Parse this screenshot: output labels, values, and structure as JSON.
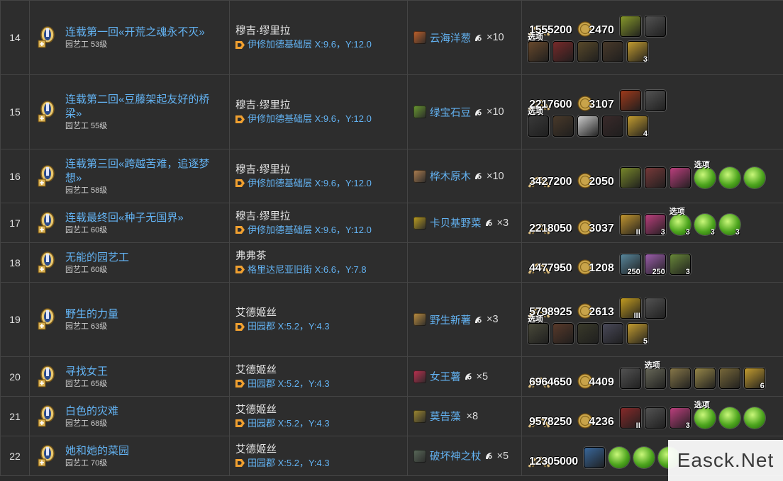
{
  "option_label": "选项",
  "rows": [
    {
      "num": "14",
      "quest": "连载第一回«开荒之魂永不灭»",
      "level": "园艺工 53级",
      "npc": "穆吉·缪里拉",
      "loc": "伊修加德基础层 X:9.6，Y:12.0",
      "item": "云海洋葱",
      "item_color": "#c4622a",
      "qty": "×10",
      "hq": true,
      "xp": "1555200",
      "gil": "2470",
      "icons": [
        {
          "c": "#8a9d2b"
        },
        {
          "c": "#555"
        }
      ],
      "icons2": [
        {
          "c": "#6a4a2c"
        },
        {
          "c": "#7a2a2a"
        },
        {
          "c": "#5a4a2a"
        },
        {
          "c": "#4a3a2a"
        },
        {
          "c": "#c8a030",
          "n": "3"
        }
      ],
      "opt": "row2"
    },
    {
      "num": "15",
      "quest": "连载第二回«豆藤架起友好的桥梁»",
      "level": "园艺工 55级",
      "npc": "穆吉·缪里拉",
      "loc": "伊修加德基础层 X:9.6，Y:12.0",
      "item": "绿宝石豆",
      "item_color": "#6a9a30",
      "qty": "×10",
      "hq": true,
      "xp": "2217600",
      "gil": "3107",
      "icons": [
        {
          "c": "#a33a1a"
        },
        {
          "c": "#555"
        }
      ],
      "icons2": [
        {
          "c": "#3a3a3a"
        },
        {
          "c": "#4a3a2a"
        },
        {
          "c": "#d0d0d0"
        },
        {
          "c": "#3a2a2a"
        },
        {
          "c": "#c8a030",
          "n": "4"
        }
      ],
      "opt": "row2"
    },
    {
      "num": "16",
      "quest": "连载第三回«跨越苦难，追逐梦想»",
      "level": "园艺工 58级",
      "npc": "穆吉·缪里拉",
      "loc": "伊修加德基础层 X:9.6，Y:12.0",
      "item": "桦木原木",
      "item_color": "#b08050",
      "qty": "×10",
      "hq": true,
      "xp": "3427200",
      "gil": "2050",
      "icons": [
        {
          "c": "#7a8a2a"
        },
        {
          "c": "#7a3a3a"
        },
        {
          "c": "#c04080"
        },
        {
          "c": "orb",
          "opt": true
        },
        {
          "c": "orb"
        },
        {
          "c": "orb"
        }
      ],
      "icons2": [],
      "opt": "inline"
    },
    {
      "num": "17",
      "quest": "连载最终回«种子无国界»",
      "level": "园艺工 60级",
      "npc": "穆吉·缪里拉",
      "loc": "伊修加德基础层 X:9.6，Y:12.0",
      "item": "卡贝基野菜",
      "item_color": "#c0a020",
      "qty": "×3",
      "hq": true,
      "xp": "2218050",
      "gil": "3037",
      "icons": [
        {
          "c": "#c89a30",
          "n": "II"
        },
        {
          "c": "#c04080",
          "n": "3"
        },
        {
          "c": "orb",
          "n": "3",
          "opt": true
        },
        {
          "c": "orb",
          "n": "3"
        },
        {
          "c": "orb",
          "n": "3"
        }
      ],
      "icons2": [],
      "opt": "inline"
    },
    {
      "num": "18",
      "quest": "无能的园艺工",
      "level": "园艺工 60级",
      "npc": "弗弗茶",
      "loc": "格里达尼亚旧街 X:6.6，Y:7.8",
      "item": "",
      "item_color": "",
      "qty": "",
      "hq": false,
      "xp": "4477950",
      "gil": "1208",
      "icons": [
        {
          "c": "#5a8aa0",
          "n": "250"
        },
        {
          "c": "#a060b0",
          "n": "250"
        },
        {
          "c": "#6a8a3a",
          "n": "3"
        }
      ],
      "icons2": [],
      "opt": "none"
    },
    {
      "num": "19",
      "quest": "野生的力量",
      "level": "园艺工 63级",
      "npc": "艾德姬丝",
      "loc": "田园郡 X:5.2，Y:4.3",
      "item": "野生新薯",
      "item_color": "#c09040",
      "qty": "×3",
      "hq": true,
      "xp": "5798925",
      "gil": "2613",
      "icons": [
        {
          "c": "#c8a020",
          "n": "III"
        },
        {
          "c": "#555"
        }
      ],
      "icons2": [
        {
          "c": "#4a4a3a"
        },
        {
          "c": "#5a3a2a"
        },
        {
          "c": "#3a3a2a"
        },
        {
          "c": "#4a4a5a"
        },
        {
          "c": "#c8a030",
          "n": "5"
        }
      ],
      "opt": "row2"
    },
    {
      "num": "20",
      "quest": "寻找女王",
      "level": "园艺工 65级",
      "npc": "艾德姬丝",
      "loc": "田园郡 X:5.2，Y:4.3",
      "item": "女王薯",
      "item_color": "#c03050",
      "qty": "×5",
      "hq": true,
      "xp": "6964650",
      "gil": "4409",
      "icons": [
        {
          "c": "#555"
        },
        {
          "c": "#6a6a5a",
          "opt": true
        },
        {
          "c": "#8a7a4a"
        },
        {
          "c": "#9a8a4a"
        },
        {
          "c": "#7a6a3a"
        },
        {
          "c": "#c8a030",
          "n": "6"
        }
      ],
      "icons2": [],
      "opt": "inline"
    },
    {
      "num": "21",
      "quest": "白色的灾难",
      "level": "园艺工 68级",
      "npc": "艾德姬丝",
      "loc": "田园郡 X:5.2，Y:4.3",
      "item": "莫告藻",
      "item_color": "#a08a30",
      "qty": "×8",
      "hq": false,
      "xp": "9578250",
      "gil": "4236",
      "icons": [
        {
          "c": "#8a2a2a",
          "n": "II"
        },
        {
          "c": "#555"
        },
        {
          "c": "#c04080",
          "n": "3"
        },
        {
          "c": "orb",
          "opt": true
        },
        {
          "c": "orb"
        },
        {
          "c": "orb"
        }
      ],
      "icons2": [],
      "opt": "inline"
    },
    {
      "num": "22",
      "quest": "她和她的菜园",
      "level": "园艺工 70级",
      "npc": "艾德姬丝",
      "loc": "田园郡 X:5.2，Y:4.3",
      "item": "破坏神之杖",
      "item_color": "#5a6a5a",
      "qty": "×5",
      "hq": true,
      "xp": "12305000",
      "gil": "",
      "icons": [
        {
          "c": "#3a6aa0"
        },
        {
          "c": "orb"
        },
        {
          "c": "orb"
        },
        {
          "c": "orb"
        }
      ],
      "icons2": [],
      "opt": "none"
    }
  ],
  "watermark": "Easck.Net"
}
